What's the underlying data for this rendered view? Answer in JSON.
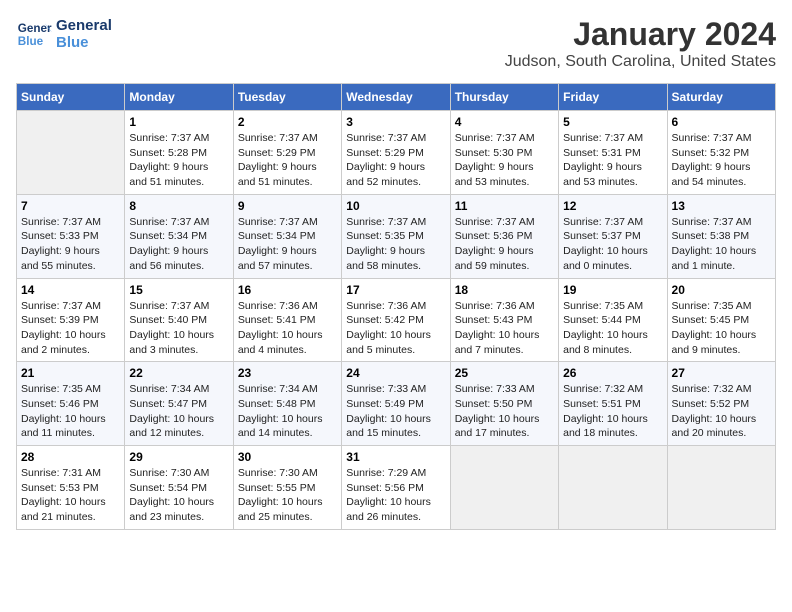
{
  "logo": {
    "line1": "General",
    "line2": "Blue"
  },
  "title": "January 2024",
  "subtitle": "Judson, South Carolina, United States",
  "days_of_week": [
    "Sunday",
    "Monday",
    "Tuesday",
    "Wednesday",
    "Thursday",
    "Friday",
    "Saturday"
  ],
  "weeks": [
    [
      {
        "day": "",
        "info": ""
      },
      {
        "day": "1",
        "info": "Sunrise: 7:37 AM\nSunset: 5:28 PM\nDaylight: 9 hours\nand 51 minutes."
      },
      {
        "day": "2",
        "info": "Sunrise: 7:37 AM\nSunset: 5:29 PM\nDaylight: 9 hours\nand 51 minutes."
      },
      {
        "day": "3",
        "info": "Sunrise: 7:37 AM\nSunset: 5:29 PM\nDaylight: 9 hours\nand 52 minutes."
      },
      {
        "day": "4",
        "info": "Sunrise: 7:37 AM\nSunset: 5:30 PM\nDaylight: 9 hours\nand 53 minutes."
      },
      {
        "day": "5",
        "info": "Sunrise: 7:37 AM\nSunset: 5:31 PM\nDaylight: 9 hours\nand 53 minutes."
      },
      {
        "day": "6",
        "info": "Sunrise: 7:37 AM\nSunset: 5:32 PM\nDaylight: 9 hours\nand 54 minutes."
      }
    ],
    [
      {
        "day": "7",
        "info": "Sunrise: 7:37 AM\nSunset: 5:33 PM\nDaylight: 9 hours\nand 55 minutes."
      },
      {
        "day": "8",
        "info": "Sunrise: 7:37 AM\nSunset: 5:34 PM\nDaylight: 9 hours\nand 56 minutes."
      },
      {
        "day": "9",
        "info": "Sunrise: 7:37 AM\nSunset: 5:34 PM\nDaylight: 9 hours\nand 57 minutes."
      },
      {
        "day": "10",
        "info": "Sunrise: 7:37 AM\nSunset: 5:35 PM\nDaylight: 9 hours\nand 58 minutes."
      },
      {
        "day": "11",
        "info": "Sunrise: 7:37 AM\nSunset: 5:36 PM\nDaylight: 9 hours\nand 59 minutes."
      },
      {
        "day": "12",
        "info": "Sunrise: 7:37 AM\nSunset: 5:37 PM\nDaylight: 10 hours\nand 0 minutes."
      },
      {
        "day": "13",
        "info": "Sunrise: 7:37 AM\nSunset: 5:38 PM\nDaylight: 10 hours\nand 1 minute."
      }
    ],
    [
      {
        "day": "14",
        "info": "Sunrise: 7:37 AM\nSunset: 5:39 PM\nDaylight: 10 hours\nand 2 minutes."
      },
      {
        "day": "15",
        "info": "Sunrise: 7:37 AM\nSunset: 5:40 PM\nDaylight: 10 hours\nand 3 minutes."
      },
      {
        "day": "16",
        "info": "Sunrise: 7:36 AM\nSunset: 5:41 PM\nDaylight: 10 hours\nand 4 minutes."
      },
      {
        "day": "17",
        "info": "Sunrise: 7:36 AM\nSunset: 5:42 PM\nDaylight: 10 hours\nand 5 minutes."
      },
      {
        "day": "18",
        "info": "Sunrise: 7:36 AM\nSunset: 5:43 PM\nDaylight: 10 hours\nand 7 minutes."
      },
      {
        "day": "19",
        "info": "Sunrise: 7:35 AM\nSunset: 5:44 PM\nDaylight: 10 hours\nand 8 minutes."
      },
      {
        "day": "20",
        "info": "Sunrise: 7:35 AM\nSunset: 5:45 PM\nDaylight: 10 hours\nand 9 minutes."
      }
    ],
    [
      {
        "day": "21",
        "info": "Sunrise: 7:35 AM\nSunset: 5:46 PM\nDaylight: 10 hours\nand 11 minutes."
      },
      {
        "day": "22",
        "info": "Sunrise: 7:34 AM\nSunset: 5:47 PM\nDaylight: 10 hours\nand 12 minutes."
      },
      {
        "day": "23",
        "info": "Sunrise: 7:34 AM\nSunset: 5:48 PM\nDaylight: 10 hours\nand 14 minutes."
      },
      {
        "day": "24",
        "info": "Sunrise: 7:33 AM\nSunset: 5:49 PM\nDaylight: 10 hours\nand 15 minutes."
      },
      {
        "day": "25",
        "info": "Sunrise: 7:33 AM\nSunset: 5:50 PM\nDaylight: 10 hours\nand 17 minutes."
      },
      {
        "day": "26",
        "info": "Sunrise: 7:32 AM\nSunset: 5:51 PM\nDaylight: 10 hours\nand 18 minutes."
      },
      {
        "day": "27",
        "info": "Sunrise: 7:32 AM\nSunset: 5:52 PM\nDaylight: 10 hours\nand 20 minutes."
      }
    ],
    [
      {
        "day": "28",
        "info": "Sunrise: 7:31 AM\nSunset: 5:53 PM\nDaylight: 10 hours\nand 21 minutes."
      },
      {
        "day": "29",
        "info": "Sunrise: 7:30 AM\nSunset: 5:54 PM\nDaylight: 10 hours\nand 23 minutes."
      },
      {
        "day": "30",
        "info": "Sunrise: 7:30 AM\nSunset: 5:55 PM\nDaylight: 10 hours\nand 25 minutes."
      },
      {
        "day": "31",
        "info": "Sunrise: 7:29 AM\nSunset: 5:56 PM\nDaylight: 10 hours\nand 26 minutes."
      },
      {
        "day": "",
        "info": ""
      },
      {
        "day": "",
        "info": ""
      },
      {
        "day": "",
        "info": ""
      }
    ]
  ]
}
